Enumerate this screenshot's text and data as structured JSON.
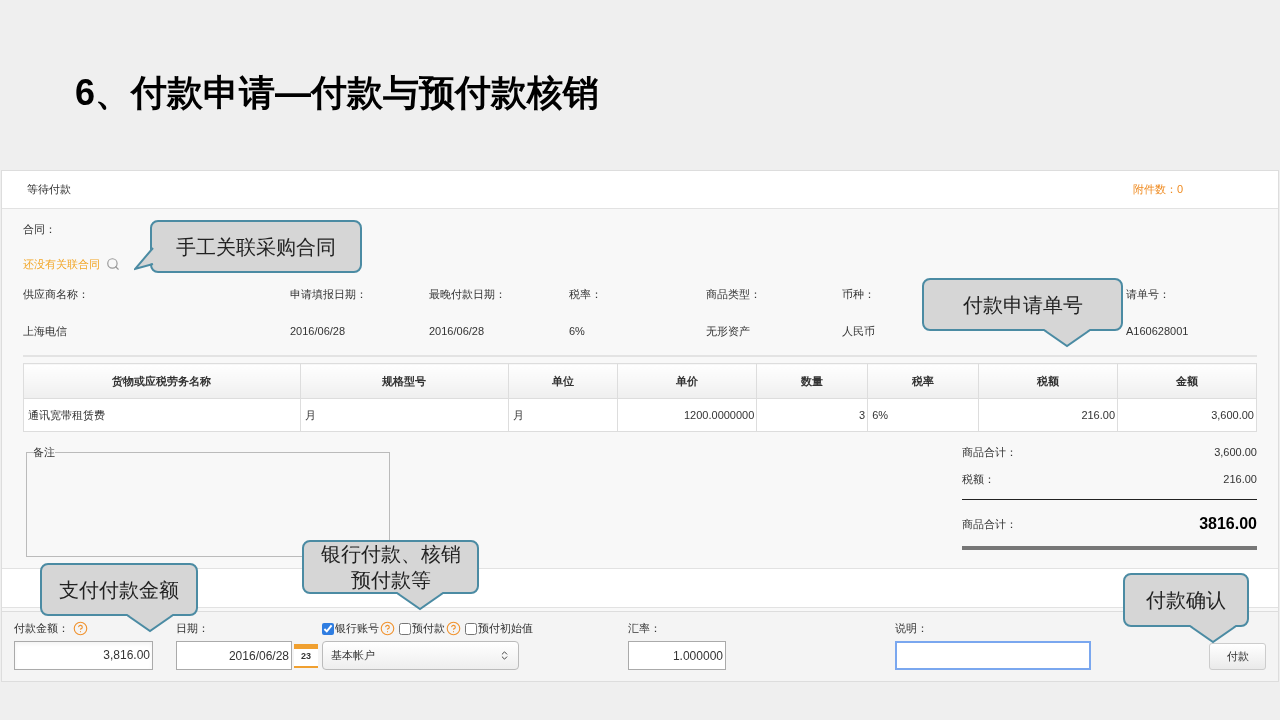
{
  "slide_title": "6、付款申请—付款与预付款核销",
  "status": "等待付款",
  "attachments": "附件数：0",
  "contract": {
    "label": "合同：",
    "link": "还没有关联合同"
  },
  "fields": [
    {
      "label": "供应商名称：",
      "value": "上海电信"
    },
    {
      "label": "申请填报日期：",
      "value": "2016/06/28"
    },
    {
      "label": "最晚付款日期：",
      "value": "2016/06/28"
    },
    {
      "label": "税率：",
      "value": "6%"
    },
    {
      "label": "商品类型：",
      "value": "无形资产"
    },
    {
      "label": "币种：",
      "value": "人民币"
    },
    {
      "label": "请单号：",
      "value": "A160628001"
    }
  ],
  "table": {
    "columns": [
      {
        "label": "货物或应税劳务名称"
      },
      {
        "label": "规格型号"
      },
      {
        "label": "单位"
      },
      {
        "label": "单价"
      },
      {
        "label": "数量"
      },
      {
        "label": "税率"
      },
      {
        "label": "税额"
      },
      {
        "label": "金额"
      }
    ],
    "rows": [
      [
        "通讯宽带租赁费",
        "月",
        "月",
        "1200.0000000",
        "3",
        "6%",
        "216.00",
        "3,600.00"
      ]
    ]
  },
  "remarks": {
    "legend": "备注"
  },
  "totals": [
    {
      "label": "商品合计：",
      "value": "3,600.00"
    },
    {
      "label": "税额：",
      "value": "216.00"
    }
  ],
  "grand_total": {
    "label": "商品合计：",
    "value": "3816.00"
  },
  "payment": {
    "amount": {
      "label": "付款金额：",
      "value": "3,816.00",
      "help": true
    },
    "date": {
      "label": "日期：",
      "value": "2016/06/28",
      "calendar_day": "23"
    },
    "options": [
      {
        "label": "银行账号",
        "checked": true,
        "help": true
      },
      {
        "label": "预付款",
        "checked": false,
        "help": true
      },
      {
        "label": "预付初始值",
        "checked": false,
        "help": false
      }
    ],
    "account": "基本帐户",
    "rate": {
      "label": "汇率：",
      "value": "1.000000"
    },
    "note": {
      "label": "说明：",
      "focused": true
    },
    "button": "付款"
  },
  "callouts": [
    {
      "lines": [
        "手工关联采购合同"
      ]
    },
    {
      "lines": [
        "付款申请单号"
      ]
    },
    {
      "lines": [
        "银行付款、核销",
        "预付款等"
      ]
    },
    {
      "lines": [
        "支付付款金额"
      ]
    },
    {
      "lines": [
        "付款确认"
      ]
    }
  ]
}
